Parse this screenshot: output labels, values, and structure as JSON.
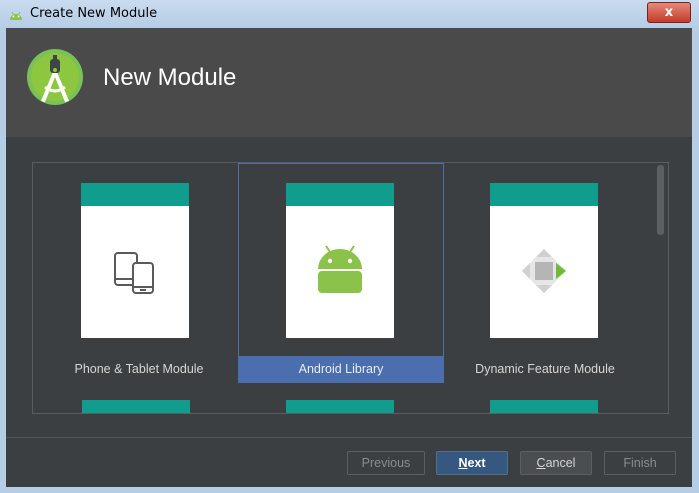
{
  "window": {
    "title": "Create New Module",
    "close_glyph": "x"
  },
  "header": {
    "title": "New Module",
    "logo": "android-studio-logo"
  },
  "templates": [
    {
      "label": "Phone & Tablet Module",
      "icon": "phone-tablet-icon",
      "selected": false
    },
    {
      "label": "Android Library",
      "icon": "android-robot-icon",
      "selected": true
    },
    {
      "label": "Dynamic Feature Module",
      "icon": "dynamic-feature-icon",
      "selected": false
    }
  ],
  "buttons": {
    "previous": "Previous",
    "next_mnemonic": "N",
    "next_rest": "ext",
    "cancel_mnemonic": "C",
    "cancel_rest": "ancel",
    "finish": "Finish"
  },
  "colors": {
    "accent_teal": "#109d8e",
    "selection_blue": "#4b6eaf",
    "primary_button": "#365880",
    "android_green": "#8bc34a"
  }
}
